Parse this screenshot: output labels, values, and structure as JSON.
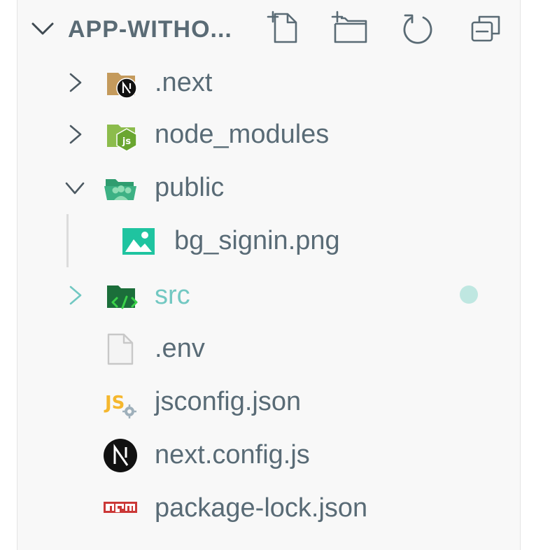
{
  "explorer": {
    "title": "APP-WITHO...",
    "actions": [
      {
        "name": "new-file-icon"
      },
      {
        "name": "new-folder-icon"
      },
      {
        "name": "refresh-icon"
      },
      {
        "name": "collapse-all-icon"
      }
    ],
    "items": [
      {
        "label": ".next",
        "type": "folder",
        "state": "collapsed",
        "icon": "nextjs-folder-icon"
      },
      {
        "label": "node_modules",
        "type": "folder",
        "state": "collapsed",
        "icon": "node-folder-icon"
      },
      {
        "label": "public",
        "type": "folder",
        "state": "expanded",
        "icon": "public-folder-icon"
      },
      {
        "label": "bg_signin.png",
        "type": "file",
        "icon": "image-file-icon"
      },
      {
        "label": "src",
        "type": "folder",
        "state": "collapsed",
        "icon": "src-folder-icon",
        "modified": true
      },
      {
        "label": ".env",
        "type": "file",
        "icon": "generic-file-icon"
      },
      {
        "label": "jsconfig.json",
        "type": "file",
        "icon": "js-config-icon"
      },
      {
        "label": "next.config.js",
        "type": "file",
        "icon": "nextjs-icon"
      },
      {
        "label": "package-lock.json",
        "type": "file",
        "icon": "npm-icon"
      }
    ]
  },
  "colors": {
    "text": "#596b76",
    "modified": "#72c8c2",
    "modified_dot": "#bfe7e1",
    "panel_bg": "#f8f8f8"
  }
}
